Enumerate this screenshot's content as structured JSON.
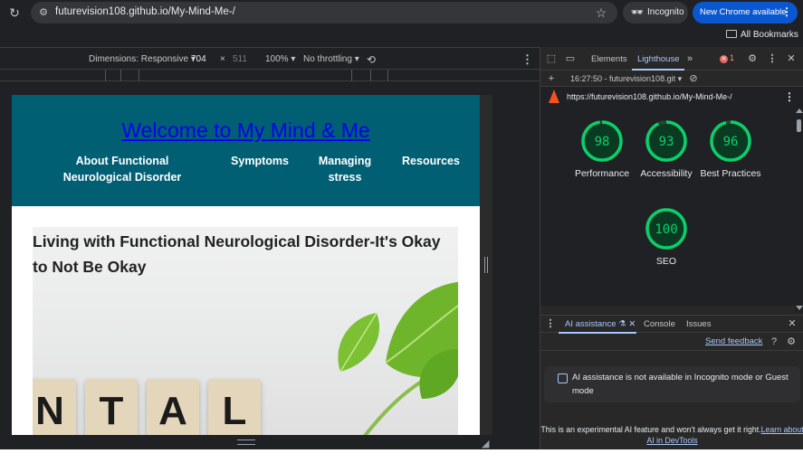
{
  "browser": {
    "url": "futurevision108.github.io/My-Mind-Me-/",
    "incognito_label": "Incognito",
    "update_label": "New Chrome available",
    "all_bookmarks_label": "All Bookmarks"
  },
  "device_toolbar": {
    "dimensions_label": "Dimensions: Responsive",
    "width": "704",
    "times": "×",
    "height": "511",
    "zoom": "100%",
    "throttling": "No throttling"
  },
  "site": {
    "title": "Welcome to My Mind & Me",
    "nav": [
      {
        "label": "About Functional Neurological Disorder"
      },
      {
        "label": "Symptoms"
      },
      {
        "label": "Managing stress"
      },
      {
        "label": "Resources"
      }
    ],
    "hero_title": "Living with Functional Neurological Disorder-It's Okay to Not Be Okay",
    "hero_tiles": [
      "N",
      "T",
      "A",
      "L"
    ]
  },
  "devtools": {
    "tabs": [
      "Elements",
      "Lighthouse"
    ],
    "error_count": "1",
    "report_select": "16:27:50 - futurevision108.git",
    "report_url": "https://futurevision108.github.io/My-Mind-Me-/",
    "gauges": [
      {
        "label": "Performance",
        "score": 98
      },
      {
        "label": "Accessibility",
        "score": 93
      },
      {
        "label": "Best Practices",
        "score": 96
      },
      {
        "label": "SEO",
        "score": 100
      }
    ],
    "drawer_tabs": [
      "AI assistance",
      "Console",
      "Issues"
    ],
    "send_feedback": "Send feedback",
    "ai_notice": "AI assistance is not available in Incognito mode or Guest mode",
    "footer_text": "This is an experimental AI feature and won't always get it right.",
    "footer_link": "Learn about AI in DevTools"
  },
  "colors": {
    "site_header": "#005f73",
    "gauge_pass": "#0cce6b",
    "devtools_accent": "#a8c7fa"
  }
}
